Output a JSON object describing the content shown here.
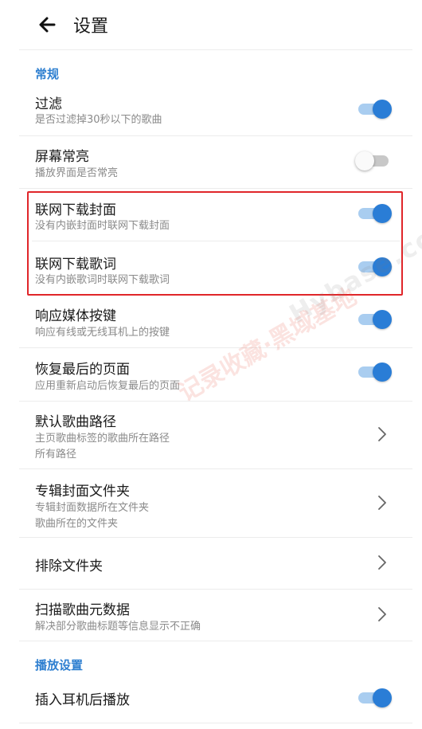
{
  "header": {
    "title": "设置"
  },
  "sections": [
    {
      "title": "常规"
    },
    {
      "title": "播放设置"
    }
  ],
  "items": [
    {
      "title": "过滤",
      "subtitle": "是否过滤掉30秒以下的歌曲",
      "toggle_on": true
    },
    {
      "title": "屏幕常亮",
      "subtitle": "播放界面是否常亮",
      "toggle_on": false
    },
    {
      "title": "联网下载封面",
      "subtitle": "没有内嵌封面时联网下载封面",
      "toggle_on": true
    },
    {
      "title": "联网下载歌词",
      "subtitle": "没有内嵌歌词时联网下载歌词",
      "toggle_on": true
    },
    {
      "title": "响应媒体按键",
      "subtitle": "响应有线或无线耳机上的按键",
      "toggle_on": true
    },
    {
      "title": "恢复最后的页面",
      "subtitle": "应用重新启动后恢复最后的页面",
      "toggle_on": true
    },
    {
      "title": "默认歌曲路径",
      "subtitle": "主页歌曲标签的歌曲所在路径",
      "value": "所有路径"
    },
    {
      "title": "专辑封面文件夹",
      "subtitle": "专辑封面数据所在文件夹",
      "value": "歌曲所在的文件夹"
    },
    {
      "title": "排除文件夹"
    },
    {
      "title": "扫描歌曲元数据",
      "subtitle": "解决部分歌曲标题等信息显示不正确"
    },
    {
      "title": "插入耳机后播放",
      "toggle_on": true
    }
  ],
  "watermark": {
    "text_cn": "记录收藏·黑域基地",
    "text_en": "Hybase.com"
  },
  "colors": {
    "accent": "#2a7dd6",
    "section": "#2e7fd0",
    "highlight": "#e0262a"
  },
  "icons": {
    "back": "arrow-left-icon",
    "chevron": "chevron-right-icon"
  }
}
